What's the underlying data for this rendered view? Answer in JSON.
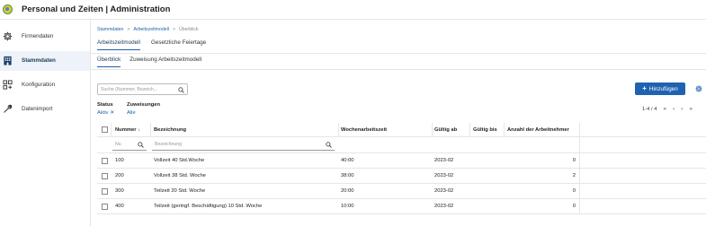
{
  "app": {
    "title": "Personal und Zeiten | Administration"
  },
  "sidebar": {
    "items": [
      {
        "label": "Firmendaten",
        "icon": "gear-icon",
        "active": false
      },
      {
        "label": "Stammdaten",
        "icon": "building-icon",
        "active": true
      },
      {
        "label": "Konfiguration",
        "icon": "configuration-icon",
        "active": false
      },
      {
        "label": "Datenimport",
        "icon": "wrench-icon",
        "active": false
      }
    ]
  },
  "breadcrumb": {
    "items": [
      "Stammdaten",
      "Arbeitszeitmodell",
      "Überblick"
    ],
    "separator": ">"
  },
  "tabs_primary": [
    "Arbeitszeitmodell",
    "Gesetzliche Feiertage"
  ],
  "tabs_secondary": [
    "Überblick",
    "Zuweisung Arbeitszeitmodell"
  ],
  "search": {
    "placeholder": "Suche (Nummer, Bezeich..."
  },
  "toolbar": {
    "add_label": "Hinzufügen",
    "add_icon": "+"
  },
  "filters": {
    "status_label": "Status",
    "status_value": "Aktiv",
    "status_clear": "✕",
    "assignments_label": "Zuweisungen",
    "assignments_value": "Alle"
  },
  "pager": {
    "range": "1-4 / 4"
  },
  "table": {
    "columns": [
      "Nummer",
      "Bezeichnung",
      "Wochenarbeitszeit",
      "Gültig ab",
      "Gültig bis",
      "Anzahl der Arbeitnehmer"
    ],
    "sort_indicator": "↓",
    "filter_placeholders": {
      "number": "Nu",
      "name": "Bezeichnung"
    },
    "rows": [
      {
        "number": "100",
        "name": "Vollzeit 40 Std.Woche",
        "hours": "40:00",
        "valid_from": "2023-02",
        "valid_to": "",
        "employees": "0"
      },
      {
        "number": "200",
        "name": "Vollzeit 38 Std. Woche",
        "hours": "38:00",
        "valid_from": "2023-02",
        "valid_to": "",
        "employees": "2"
      },
      {
        "number": "300",
        "name": "Teilzeit 20 Std. Woche",
        "hours": "20:00",
        "valid_from": "2023-02",
        "valid_to": "",
        "employees": "0"
      },
      {
        "number": "400",
        "name": "Teilzeit (geringf. Beschäftigung) 10 Std. Woche",
        "hours": "10:00",
        "valid_from": "2023-02",
        "valid_to": "",
        "employees": "0"
      }
    ]
  },
  "colors": {
    "accent": "#1e62b0",
    "active_bg": "#eef3f9"
  }
}
